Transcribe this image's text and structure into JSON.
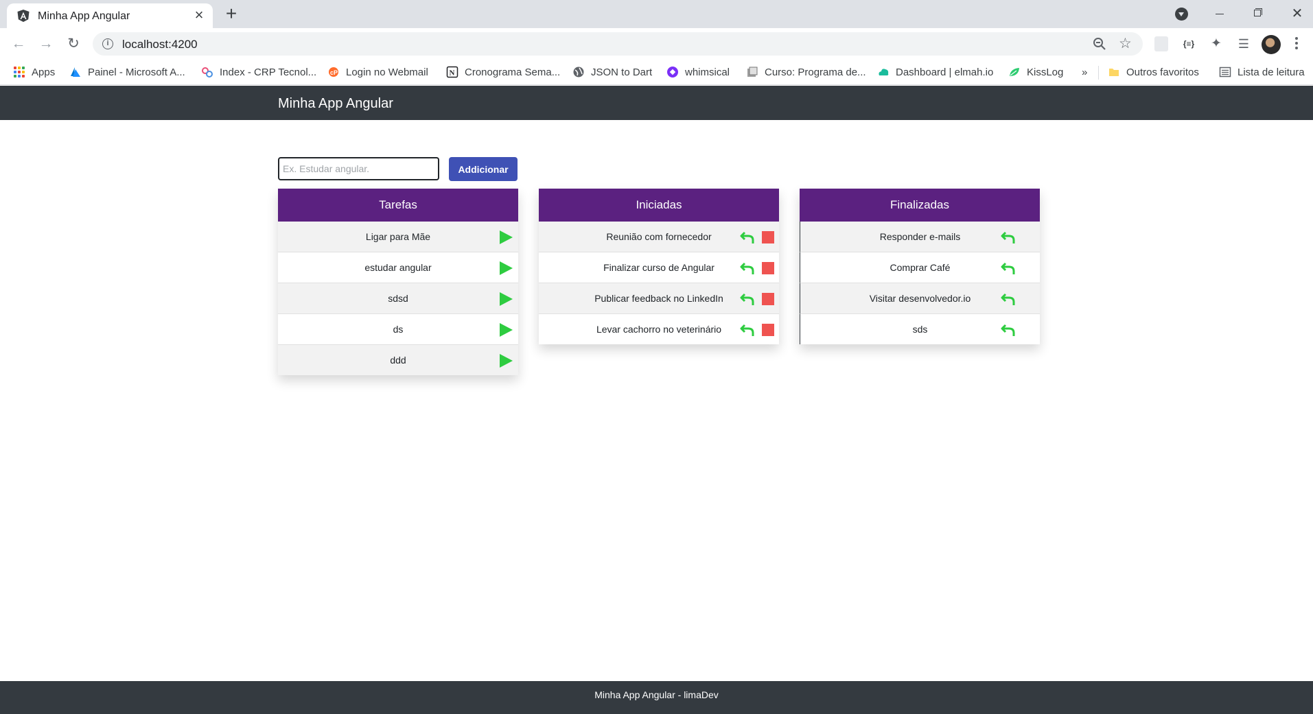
{
  "browser": {
    "tab_title": "Minha App Angular",
    "url": "localhost:4200",
    "bookmarks": [
      {
        "label": "Apps",
        "icon": "apps-grid-icon"
      },
      {
        "label": "Painel - Microsoft A...",
        "icon": "azure-icon"
      },
      {
        "label": "Index - CRP Tecnol...",
        "icon": "crp-icon"
      },
      {
        "label": "Login no Webmail",
        "icon": "cpanel-icon"
      },
      {
        "label": "Cronograma Sema...",
        "icon": "notion-icon"
      },
      {
        "label": "JSON to Dart",
        "icon": "globe-icon"
      },
      {
        "label": "whimsical",
        "icon": "whimsical-icon"
      },
      {
        "label": "Curso: Programa de...",
        "icon": "course-icon"
      },
      {
        "label": "Dashboard | elmah.io",
        "icon": "elmah-icon"
      },
      {
        "label": "KissLog",
        "icon": "kisslog-icon"
      }
    ],
    "overflow_label": "»",
    "other_bookmarks": "Outros favoritos",
    "reading_list": "Lista de leitura"
  },
  "app": {
    "title": "Minha App Angular",
    "input_placeholder": "Ex. Estudar angular.",
    "add_button": "Addicionar",
    "footer": "Minha App Angular - limaDev",
    "colors": {
      "header": "#343a40",
      "column_header": "#5b2180",
      "button": "#3f51b5",
      "play": "#2ecc40",
      "stop": "#ef5350"
    }
  },
  "columns": {
    "tarefas": {
      "title": "Tarefas",
      "items": [
        "Ligar para Mãe",
        "estudar angular",
        "sdsd",
        "ds",
        "ddd"
      ]
    },
    "iniciadas": {
      "title": "Iniciadas",
      "items": [
        "Reunião com fornecedor",
        "Finalizar curso de Angular",
        "Publicar feedback no LinkedIn",
        "Levar cachorro no veterinário"
      ]
    },
    "finalizadas": {
      "title": "Finalizadas",
      "items": [
        "Responder e-mails",
        "Comprar Café",
        "Visitar desenvolvedor.io",
        "sds"
      ]
    }
  }
}
